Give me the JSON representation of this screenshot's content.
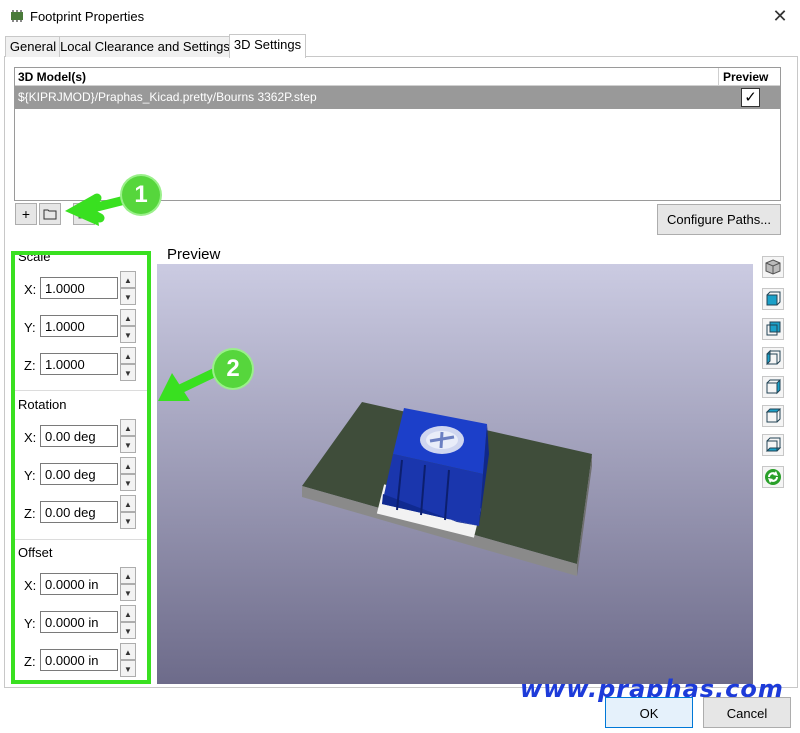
{
  "window": {
    "title": "Footprint Properties",
    "close_glyph": "✕"
  },
  "tabs": [
    {
      "label": "General"
    },
    {
      "label": "Local Clearance and Settings"
    },
    {
      "label": "3D Settings",
      "active": true
    }
  ],
  "models": {
    "header_model": "3D Model(s)",
    "header_preview": "Preview",
    "rows": [
      {
        "path": "${KIPRJMOD}/Praphas_Kicad.pretty/Bourns 3362P.step",
        "preview": true
      }
    ]
  },
  "toolbar": {
    "add_glyph": "+",
    "folder_icon": "folder-icon",
    "configure_label": "Configure Paths..."
  },
  "annotations": {
    "badge_1": "1",
    "badge_2": "2",
    "watermark": "www.praphas.com",
    "color": "#39e020"
  },
  "transform": {
    "scale": {
      "label": "Scale",
      "x": "1.0000",
      "y": "1.0000",
      "z": "1.0000"
    },
    "rotation": {
      "label": "Rotation",
      "x": "0.00 deg",
      "y": "0.00 deg",
      "z": "0.00 deg"
    },
    "offset": {
      "label": "Offset",
      "x": "0.0000 in",
      "y": "0.0000 in",
      "z": "0.0000 in"
    },
    "axis_x": "X:",
    "axis_y": "Y:",
    "axis_z": "Z:",
    "spin_up": "▲",
    "spin_down": "▼"
  },
  "preview": {
    "label": "Preview"
  },
  "view_buttons": [
    "view-3d-icon",
    "view-front-icon",
    "view-back-icon",
    "view-left-icon",
    "view-right-icon",
    "view-top-icon",
    "view-bottom-icon",
    "reload-icon"
  ],
  "dialog": {
    "ok_label": "OK",
    "cancel_label": "Cancel"
  },
  "colors": {
    "accent_green": "#39e020",
    "selection": "#999999",
    "watermark": "#1d3bd9"
  }
}
